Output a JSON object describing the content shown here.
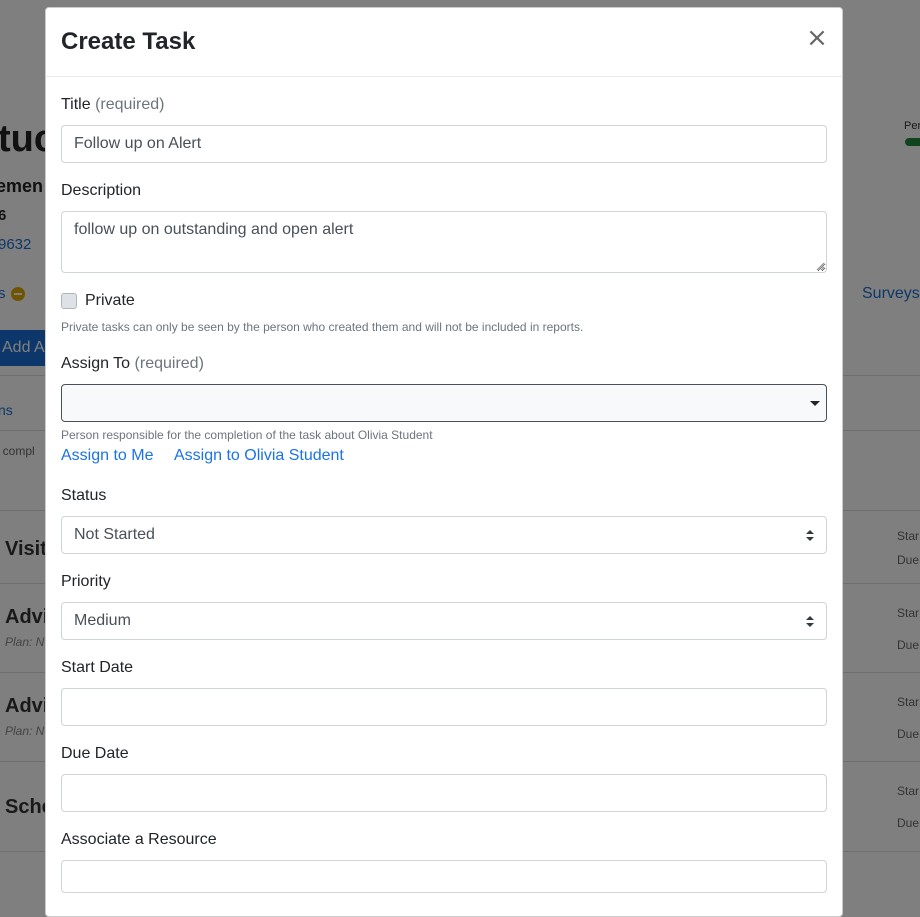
{
  "background": {
    "title_fragment": "tuc",
    "subtitle_fragment": "emen",
    "number_fragment": "6",
    "id_fragment": "9632",
    "alerts_fragment": "s",
    "add_button_fragment": "Add A",
    "tab_fragment": "ns",
    "note_fragment": "t compl",
    "surveys_link": "Surveys",
    "progress_label": "Per",
    "rows": [
      {
        "title": "Visit",
        "plan": "",
        "meta_top": "Star",
        "meta_bottom": "Due"
      },
      {
        "title": "Advi",
        "plan": "Plan: N",
        "meta_top": "Star",
        "meta_bottom": "Due"
      },
      {
        "title": "Advi",
        "plan": "Plan: N",
        "meta_top": "Star",
        "meta_bottom": "Due"
      },
      {
        "title": "Sche",
        "plan": "",
        "meta_top": "Star",
        "meta_bottom": "Due"
      }
    ]
  },
  "modal": {
    "title": "Create Task",
    "close_glyph": "×",
    "title_field": {
      "label": "Title",
      "required": "(required)",
      "value": "Follow up on Alert"
    },
    "description": {
      "label": "Description",
      "value": "follow up on outstanding and open alert"
    },
    "private": {
      "label": "Private",
      "help": "Private tasks can only be seen by the person who created them and will not be included in reports."
    },
    "assign_to": {
      "label": "Assign To",
      "required": "(required)",
      "value": "",
      "help": "Person responsible for the completion of the task about Olivia Student",
      "link_me": "Assign to Me",
      "link_student": "Assign to Olivia Student"
    },
    "status": {
      "label": "Status",
      "value": "Not Started"
    },
    "priority": {
      "label": "Priority",
      "value": "Medium"
    },
    "start_date": {
      "label": "Start Date",
      "value": ""
    },
    "due_date": {
      "label": "Due Date",
      "value": ""
    },
    "resource": {
      "label": "Associate a Resource",
      "value": ""
    }
  }
}
